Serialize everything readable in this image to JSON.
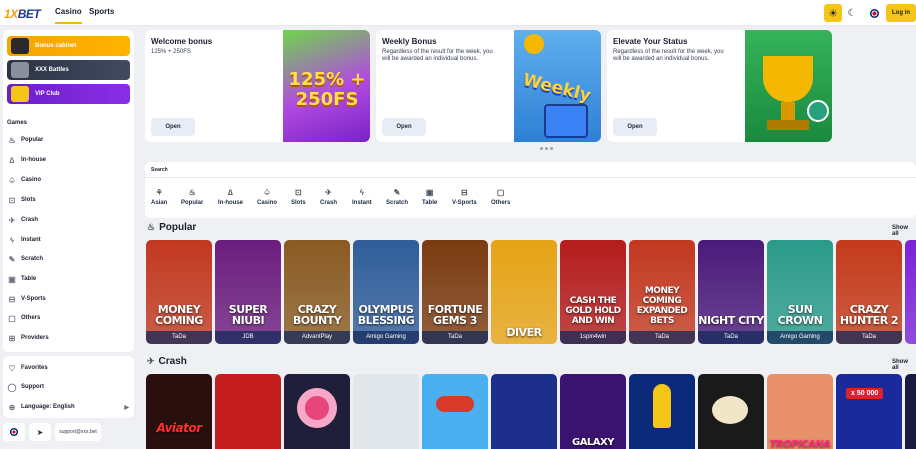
{
  "header": {
    "logo_text": "BET",
    "logo_prefix": "1X",
    "tabs": [
      {
        "label": "Casino"
      },
      {
        "label": "Sports"
      }
    ],
    "login_label": "Log in"
  },
  "sidebar": {
    "promos": [
      {
        "label": "Bonus cabinet",
        "color": "#f5a400"
      },
      {
        "label": "XXX Battles",
        "color": "#2c3345"
      },
      {
        "label": "VIP Club",
        "color": "#7b22d8"
      }
    ],
    "games_title": "Games",
    "items": [
      {
        "label": "Popular",
        "icon": "fire-icon"
      },
      {
        "label": "In-house",
        "icon": "flame-icon"
      },
      {
        "label": "Casino",
        "icon": "spade-icon"
      },
      {
        "label": "Slots",
        "icon": "slot-icon"
      },
      {
        "label": "Crash",
        "icon": "plane-icon"
      },
      {
        "label": "Instant",
        "icon": "lightning-icon"
      },
      {
        "label": "Scratch",
        "icon": "scratch-icon"
      },
      {
        "label": "Table",
        "icon": "cards-icon"
      },
      {
        "label": "V-Sports",
        "icon": "gamepad-icon"
      },
      {
        "label": "Others",
        "icon": "box-icon"
      },
      {
        "label": "Providers",
        "icon": "providers-icon"
      }
    ],
    "bottom_items": [
      {
        "label": "Favorites",
        "icon": "heart-icon"
      },
      {
        "label": "Support",
        "icon": "chat-icon"
      },
      {
        "label": "Language: English",
        "icon": "globe-icon"
      }
    ],
    "support_email": "support@xxx.bet"
  },
  "banners": [
    {
      "title": "Welcome bonus",
      "subtitle": "125% + 250FS",
      "button": "Open",
      "art_text": "125% + 250FS"
    },
    {
      "title": "Weekly Bonus",
      "subtitle": "Regardless of the result for the week, you will be awarded an individual bonus.",
      "button": "Open",
      "art_text": "Weekly"
    },
    {
      "title": "Elevate Your Status",
      "subtitle": "Regardless of the result for the week, you will be awarded an individual bonus.",
      "button": "Open",
      "art_text": ""
    }
  ],
  "search": {
    "label": "Search"
  },
  "categories": [
    {
      "label": "Asian",
      "icon": "fan-icon"
    },
    {
      "label": "Popular",
      "icon": "fire-icon"
    },
    {
      "label": "In-house",
      "icon": "flame-icon"
    },
    {
      "label": "Casino",
      "icon": "spade-icon"
    },
    {
      "label": "Slots",
      "icon": "slot-icon"
    },
    {
      "label": "Crash",
      "icon": "plane-icon"
    },
    {
      "label": "Instant",
      "icon": "lightning-icon"
    },
    {
      "label": "Scratch",
      "icon": "scratch-icon"
    },
    {
      "label": "Table",
      "icon": "cards-icon"
    },
    {
      "label": "V-Sports",
      "icon": "gamepad-icon"
    },
    {
      "label": "Others",
      "icon": "box-icon"
    }
  ],
  "popular": {
    "title": "Popular",
    "show_all": "Show all",
    "games": [
      {
        "name": "MONEY COMING",
        "provider": "TaDa",
        "color": "#c2381f"
      },
      {
        "name": "SUPER NIUBI",
        "provider": "JDB",
        "color": "#6b1d7e"
      },
      {
        "name": "CRAZY BOUNTY",
        "provider": "AdvantPlay",
        "color": "#8a5a22"
      },
      {
        "name": "OLYMPUS BLESSING",
        "provider": "Amigo Gaming",
        "color": "#2f5d9a"
      },
      {
        "name": "FORTUNE GEMS 3",
        "provider": "TaDa",
        "color": "#7a3b10"
      },
      {
        "name": "DIVER",
        "provider": "",
        "color": "#e6a315"
      },
      {
        "name": "CASH THE GOLD HOLD AND WIN",
        "provider": "1spin4win",
        "color": "#b51c1c"
      },
      {
        "name": "MONEY COMING EXPANDED BETS",
        "provider": "TaDa",
        "color": "#c2381f"
      },
      {
        "name": "NIGHT CITY",
        "provider": "TaDa",
        "color": "#4a1a7a"
      },
      {
        "name": "SUN CROWN",
        "provider": "Amigo Gaming",
        "color": "#2a9a8a"
      },
      {
        "name": "CRAZY HUNTER 2",
        "provider": "TaDa",
        "color": "#c43a1a"
      },
      {
        "name": "CR",
        "provider": "",
        "color": "#7b22d8"
      }
    ]
  },
  "crash": {
    "title": "Crash",
    "show_all": "Show all",
    "games": [
      {
        "name": "Aviator",
        "color": "#2a0f0f"
      },
      {
        "name": "",
        "color": "#c41e1e"
      },
      {
        "name": "",
        "color": "#1f1f3a"
      },
      {
        "name": "",
        "color": "#e0e6ea"
      },
      {
        "name": "",
        "color": "#4ab0f0"
      },
      {
        "name": "",
        "color": "#1d2f8a"
      },
      {
        "name": "GALAXY",
        "color": "#3a1270"
      },
      {
        "name": "",
        "color": "#0c2a7a"
      },
      {
        "name": "",
        "color": "#1a1a1a"
      },
      {
        "name": "TROPICANA",
        "color": "#e8906a"
      },
      {
        "name": "x 50 000",
        "color": "#1b2a9a"
      },
      {
        "name": "",
        "color": "#1a1a40"
      }
    ]
  }
}
